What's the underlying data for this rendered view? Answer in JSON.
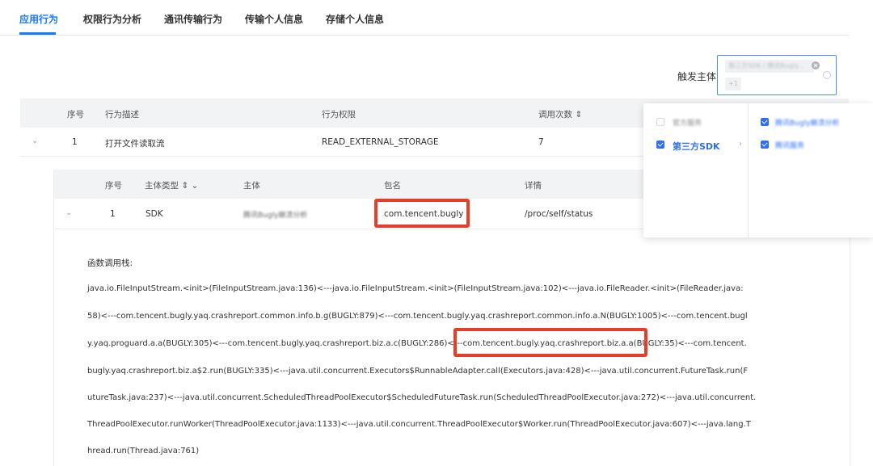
{
  "tabs": [
    {
      "label": "应用行为",
      "active": true
    },
    {
      "label": "权限行为分析"
    },
    {
      "label": "通讯传输行为"
    },
    {
      "label": "传输个人信息"
    },
    {
      "label": "存储个人信息"
    }
  ],
  "filter": {
    "label": "触发主体",
    "selected_tag": "第三方SDK / 腾讯Bugly...",
    "more_tag": "+1"
  },
  "dropdown": {
    "col1": [
      {
        "label": "官方服务",
        "checked": false
      },
      {
        "label": "第三方SDK",
        "checked": true
      }
    ],
    "col2": [
      {
        "label": "腾讯Bugly崩溃分析",
        "checked": true
      },
      {
        "label": "腾讯服务",
        "checked": true
      }
    ]
  },
  "table": {
    "headers": {
      "index": "序号",
      "desc": "行为描述",
      "perm": "行为权限",
      "count": "调用次数 ⇕"
    },
    "row": {
      "index": "1",
      "desc": "打开文件读取流",
      "perm": "READ_EXTERNAL_STORAGE",
      "count": "7"
    }
  },
  "sub_table": {
    "headers": {
      "index": "序号",
      "type": "主体类型 ⇕ ⌄",
      "subject": "主体",
      "package": "包名",
      "detail": "详情"
    },
    "row": {
      "index": "1",
      "type": "SDK",
      "subject": "腾讯Bugly崩溃分析",
      "package": "com.tencent.bugly",
      "detail": "/proc/self/status"
    }
  },
  "call_stack": {
    "label": "函数调用栈:",
    "lines": [
      "java.io.FileInputStream.<init>(FileInputStream.java:136)<---java.io.FileInputStream.<init>(FileInputStream.java:102)<---java.io.FileReader.<init>(FileReader.java:",
      "58)<---com.tencent.bugly.yaq.crashreport.common.info.b.g(BUGLY:879)<---com.tencent.bugly.yaq.crashreport.common.info.a.N(BUGLY:1005)<---com.tencent.bugl",
      "y.yaq.proguard.a.a(BUGLY:305)<---com.tencent.bugly.yaq.crashreport.biz.a.c(BUGLY:286)<---com.tencent.bugly.yaq.crashreport.biz.a.a(BUGLY:35)<---com.tencent.",
      "bugly.yaq.crashreport.biz.a$2.run(BUGLY:335)<---java.util.concurrent.Executors$RunnableAdapter.call(Executors.java:428)<---java.util.concurrent.FutureTask.run(F",
      "utureTask.java:237)<---java.util.concurrent.ScheduledThreadPoolExecutor$ScheduledFutureTask.run(ScheduledThreadPoolExecutor.java:272)<---java.util.concurrent.",
      "ThreadPoolExecutor.runWorker(ThreadPoolExecutor.java:1133)<---java.util.concurrent.ThreadPoolExecutor$Worker.run(ThreadPoolExecutor.java:607)<---java.lang.T",
      "hread.run(Thread.java:761)"
    ]
  },
  "colors": {
    "accent": "#1677ff",
    "highlight": "#e53e29"
  }
}
